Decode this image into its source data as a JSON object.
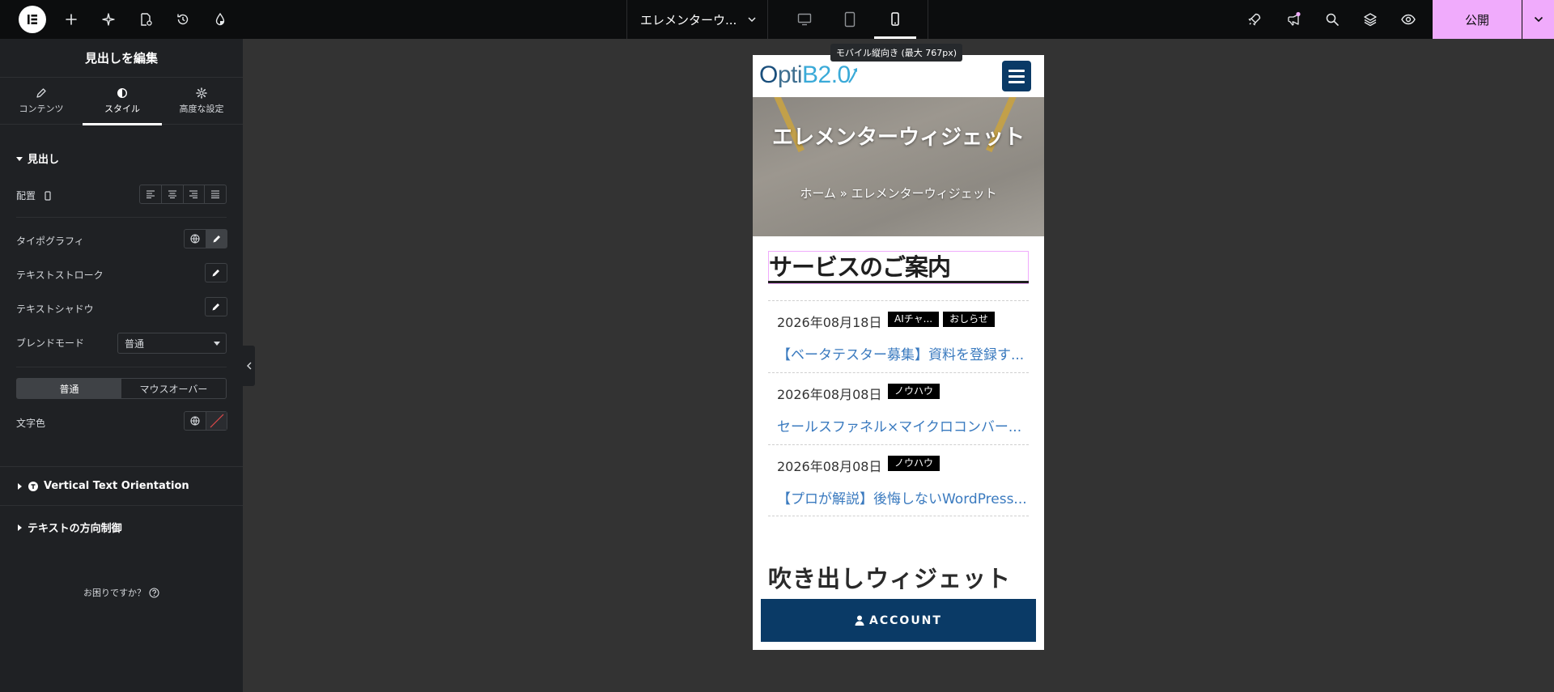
{
  "topbar": {
    "document_title": "エレメンターウ...",
    "publish_label": "公開",
    "device_tooltip": "モバイル縦向き (最大 767px)"
  },
  "panel": {
    "title": "見出しを編集",
    "tabs": [
      {
        "label": "コンテンツ",
        "icon": "pencil-icon"
      },
      {
        "label": "スタイル",
        "icon": "half-circle-icon"
      },
      {
        "label": "高度な設定",
        "icon": "gear-icon"
      }
    ],
    "active_tab": "スタイル",
    "section_heading": "見出し",
    "alignment_label": "配置",
    "typography_label": "タイポグラフィ",
    "text_stroke_label": "テキストストローク",
    "text_shadow_label": "テキストシャドウ",
    "blend_mode_label": "ブレンドモード",
    "blend_mode_value": "普通",
    "state_tabs": [
      "普通",
      "マウスオーバー"
    ],
    "active_state": "普通",
    "text_color_label": "文字色",
    "section_vertical": "Vertical Text Orientation",
    "section_direction": "テキストの方向制御",
    "help_text": "お困りですか？"
  },
  "preview": {
    "logo_o": "O",
    "logo_pti": "pti",
    "logo_b2": "B2.0",
    "hero_title": "エレメンターウィジェット",
    "breadcrumb": "ホーム » エレメンターウィジェット",
    "heading": "サービスのご案内",
    "posts": [
      {
        "date": "2026年08月18日",
        "cats": [
          "AIチャ...",
          "おしらせ"
        ],
        "title": "【ベータテスター募集】資料を登録す..."
      },
      {
        "date": "2026年08月08日",
        "cats": [
          "ノウハウ"
        ],
        "title": "セールスファネル×マイクロコンバー..."
      },
      {
        "date": "2026年08月08日",
        "cats": [
          "ノウハウ"
        ],
        "title": "【プロが解説】後悔しないWordPress..."
      }
    ],
    "section2_heading": "吹き出しウィジェット",
    "account_label": "ACCOUNT"
  },
  "colors": {
    "accent_publish": "#f0abfc",
    "panel_bg": "#1f2124",
    "canvas_bg": "#333333",
    "site_navy": "#0a3a66",
    "link_blue": "#3a7abf"
  }
}
